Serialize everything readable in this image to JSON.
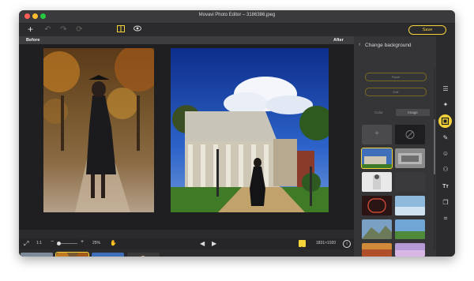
{
  "window": {
    "title": "Movavi Photo Editor – 3186386.jpeg"
  },
  "toolbar": {
    "save_label": "Save"
  },
  "compare": {
    "before_label": "Before",
    "after_label": "After"
  },
  "bottombar": {
    "ratio": "1:1",
    "zoom": "25%",
    "dimensions": "1831×1920"
  },
  "panel": {
    "title": "Change background",
    "back_icon": "chevron-left-icon",
    "finish_label": "Finish",
    "edit_label": "Edit",
    "tabs": [
      {
        "label": "Color",
        "active": false
      },
      {
        "label": "Image",
        "active": true
      }
    ]
  },
  "rail": {
    "icons": [
      "sliders-icon",
      "magic-enhance-icon",
      "background-icon",
      "eraser-icon",
      "face-icon",
      "layers-icon",
      "text-icon",
      "overlay-icon",
      "crop-icon"
    ],
    "active_index": 2
  },
  "filmstrip": {
    "count": 4,
    "selected_index": 1
  },
  "colors": {
    "accent": "#f5d33a",
    "window_bg": "#2b2b2d",
    "panel_bg": "#353537"
  }
}
